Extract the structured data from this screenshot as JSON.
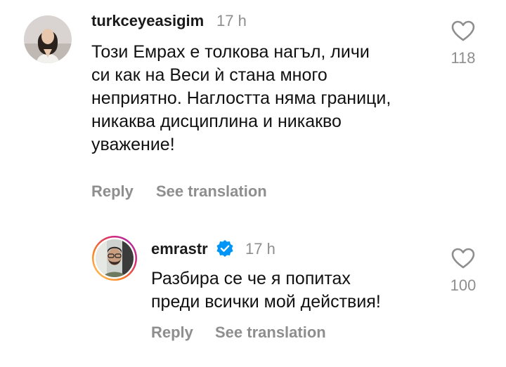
{
  "comments": [
    {
      "username": "turkceyeasigim",
      "time": "17 h",
      "lines": [
        "Този Емрах е толкова нагъл, личи",
        "си как на Веси ѝ стана много",
        "неприятно. Наглостта няма граници,",
        "никаква дисциплина и никакво",
        "уважение!"
      ],
      "likes": "118",
      "reply_label": "Reply",
      "translate_label": "See translation",
      "avatar_icon": "woman-portrait-avatar"
    },
    {
      "username": "emrastr",
      "verified_icon": "verified-badge-icon",
      "verified_color": "#0095f6",
      "time": "17 h",
      "lines": [
        "Разбира се че я попитах",
        "преди всички мой действия!"
      ],
      "likes": "100",
      "reply_label": "Reply",
      "translate_label": "See translation",
      "avatar_icon": "man-in-car-avatar-with-story-ring"
    }
  ],
  "colors": {
    "muted": "#8e8e8e",
    "text": "#111111",
    "story_ring": [
      "#feda75",
      "#fa7e1e",
      "#d62976",
      "#962fbf"
    ]
  }
}
